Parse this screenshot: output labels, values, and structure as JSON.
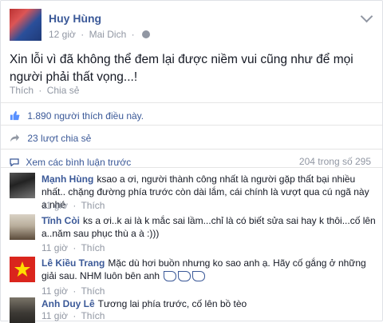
{
  "post": {
    "author": "Huy Hùng",
    "time": "12 giờ",
    "location": "Mai Dich",
    "text": "Xin lỗi vì đã không thể đem lại được niềm vui cũng như để mọi người phải thất vọng...!",
    "like_label": "Thích",
    "share_label": "Chia sẻ",
    "likes_text": "1.890 người thích điều này.",
    "shares_text": "23 lượt chia sẻ"
  },
  "comments_header": {
    "view_more": "Xem các bình luận trước",
    "count": "204 trong số 295"
  },
  "comments": [
    {
      "name": "Mạnh Hùng",
      "text": "ksao a ơi, người thành công nhất là người gặp thất bại nhiều nhất.. chặng đường phía trước còn dài lắm, cái chính là vượt qua cú ngã này a nhé",
      "time": "11 giờ",
      "like_label": "Thích"
    },
    {
      "name": "Tĩnh Còi",
      "text": "ks a ơi..k ai là k mắc sai lầm...chỉ là có biết sửa sai hay k thôi...cố lên a..năm sau phục thù a à :)))",
      "time": "11 giờ",
      "like_label": "Thích"
    },
    {
      "name": "Lê Kiều Trang",
      "text": "Mặc dù hơi buồn nhưng ko sao anh ạ. Hãy cố gắng ở những giải sau. NHM luôn bên anh",
      "time": "11 giờ",
      "like_label": "Thích"
    },
    {
      "name": "Anh Duy Lê",
      "text": "Tương lai phía trước, cố lên bồ tèo",
      "time": "11 giờ",
      "like_label": "Thích"
    }
  ],
  "colors": {
    "link": "#3b5998",
    "muted": "#9197a3",
    "text": "#141823"
  }
}
